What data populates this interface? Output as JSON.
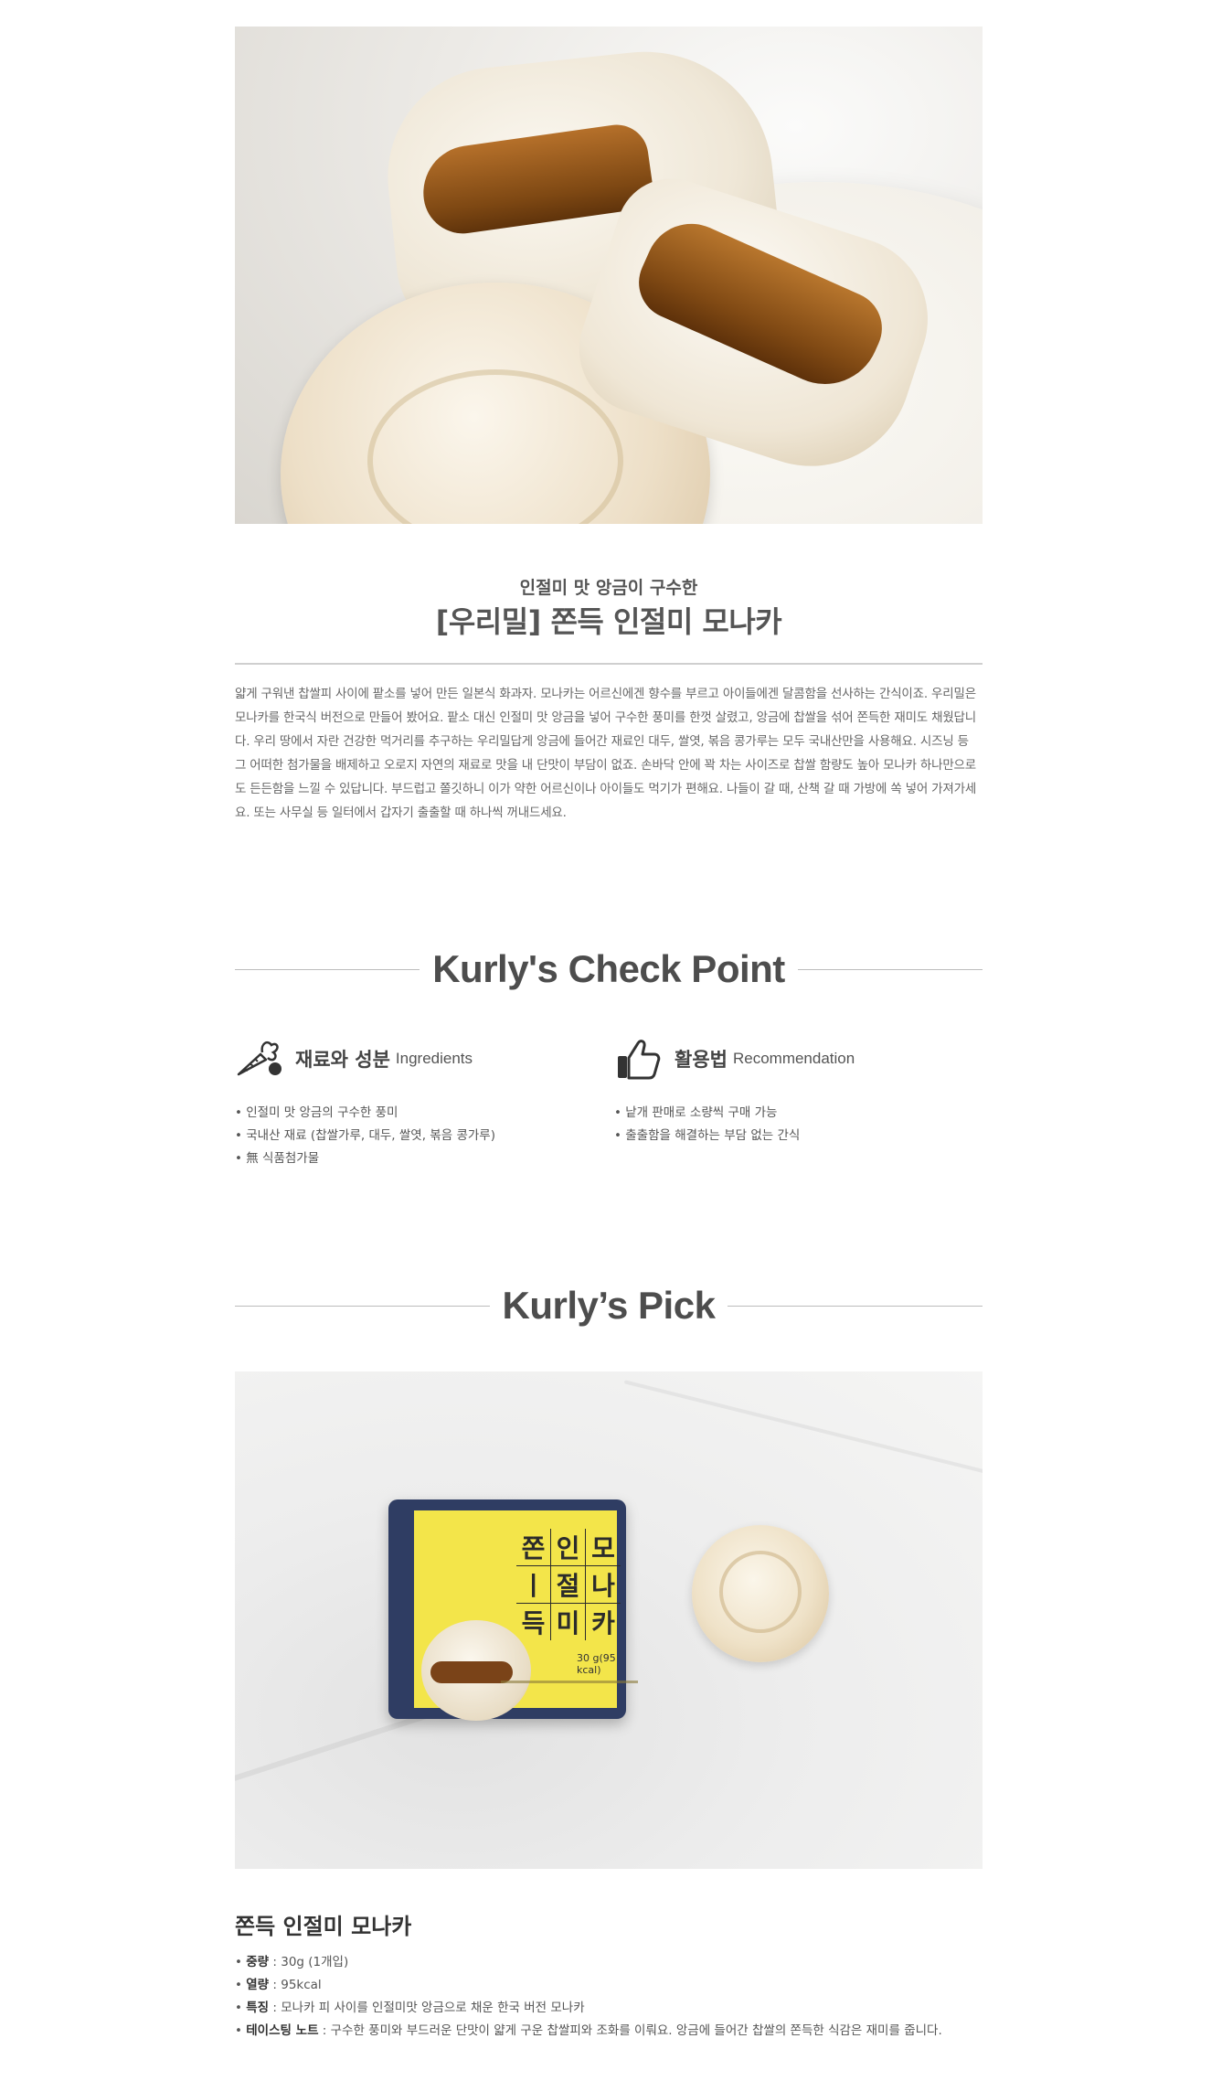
{
  "intro": {
    "subtitle": "인절미 맛 앙금이 구수한",
    "title": "[우리밀] 쫀득 인절미 모나카",
    "description": "얇게 구워낸 찹쌀피 사이에 팥소를 넣어 만든 일본식 화과자. 모나카는 어르신에겐 향수를 부르고 아이들에겐 달콤함을 선사하는 간식이죠. 우리밀은 모나카를 한국식 버전으로 만들어 봤어요. 팥소 대신 인절미 맛 앙금을 넣어 구수한 풍미를 한껏 살렸고, 앙금에 찹쌀을 섞어 쫀득한 재미도 채웠답니다. 우리 땅에서 자란 건강한 먹거리를 추구하는 우리밀답게 앙금에 들어간 재료인 대두, 쌀엿, 볶음 콩가루는 모두 국내산만을 사용해요. 시즈닝 등 그 어떠한 첨가물을 배제하고 오로지 자연의 재료로 맛을 내 단맛이 부담이 없죠. 손바닥 안에 꽉 차는 사이즈로 찹쌀 함량도 높아 모나카 하나만으로도 든든함을 느낄 수 있답니다. 부드럽고 쫄깃하니 이가 약한 어르신이나 아이들도 먹기가 편해요. 나들이 갈 때, 산책 갈 때 가방에 쏙 넣어 가져가세요. 또는 사무실 등 일터에서 갑자기 출출할 때 하나씩 꺼내드세요."
  },
  "check_point": {
    "heading": "Kurly's Check Point",
    "ingredients": {
      "icon": "carrot-herb-icon",
      "title": "재료와 성분",
      "title_en": "Ingredients",
      "items": [
        "• 인절미 맛 앙금의 구수한 풍미",
        "• 국내산 재료 (찹쌀가루, 대두, 쌀엿, 볶음 콩가루)",
        "• 無 식품첨가물"
      ]
    },
    "recommendation": {
      "icon": "thumbs-up-icon",
      "title": "활용법",
      "title_en": "Recommendation",
      "items": [
        "• 낱개 판매로 소량씩 구매 가능",
        "• 출출함을 해결하는 부담 없는 간식"
      ]
    }
  },
  "pick": {
    "heading": "Kurly’s Pick",
    "package_chars": [
      "쫀",
      "인",
      "모",
      "ㅣ",
      "절",
      "나",
      "득",
      "미",
      "카"
    ],
    "package_weight": "30 g(95 kcal)",
    "product_name": "쫀득 인절미 모나카",
    "specs": [
      {
        "label": "중량",
        "value": " : 30g (1개입)"
      },
      {
        "label": "열량",
        "value": " : 95kcal"
      },
      {
        "label": "특징",
        "value": " : 모나카 피 사이를 인절미맛 앙금으로 채운 한국 버전 모나카"
      },
      {
        "label": "테이스팅 노트",
        "value": " : 구수한 풍미와 부드러운 단맛이 얇게 구운 찹쌀피와 조화를 이뤄요. 앙금에 들어간 찹쌀의 쫀득한 식감은 재미를 줍니다."
      }
    ]
  }
}
